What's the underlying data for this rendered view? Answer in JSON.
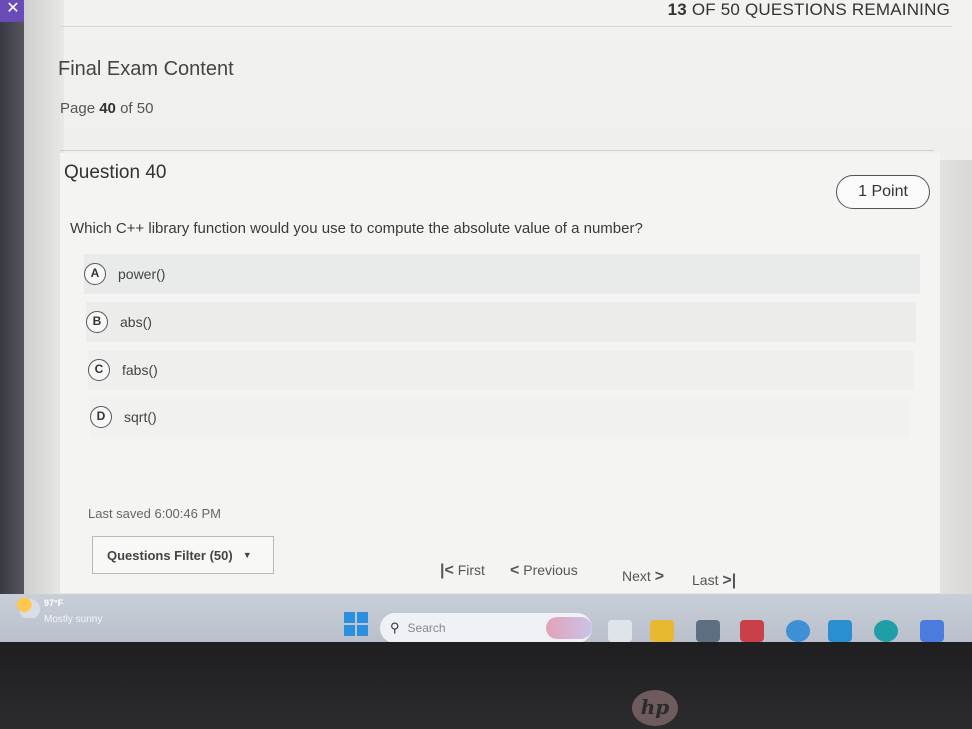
{
  "header": {
    "remaining_count": "13",
    "remaining_text": "OF 50 QUESTIONS REMAINING",
    "close_glyph": "✕"
  },
  "exam": {
    "title": "Final Exam Content",
    "page_label": "Page",
    "page_current": "40",
    "page_of": "of 50"
  },
  "question": {
    "title": "Question 40",
    "points": "1 Point",
    "text": "Which C++ library function would you use to compute the absolute value of a number?",
    "options": [
      {
        "letter": "A",
        "label": "power()"
      },
      {
        "letter": "B",
        "label": "abs()"
      },
      {
        "letter": "C",
        "label": "fabs()"
      },
      {
        "letter": "D",
        "label": "sqrt()"
      }
    ]
  },
  "footer": {
    "last_saved": "Last saved 6:00:46 PM",
    "filter_label": "Questions Filter (50)",
    "nav_first": "First",
    "nav_previous": "Previous",
    "nav_next": "Next",
    "nav_last": "Last"
  },
  "taskbar": {
    "weather_temp": "97°F",
    "weather_desc": "Mostly sunny",
    "search_placeholder": "Search"
  },
  "device": {
    "brand": "hp"
  },
  "icons": {
    "close": "close-icon",
    "caret": "chevron-down-icon",
    "first": "skip-first-icon",
    "previous": "chevron-left-icon",
    "next": "chevron-right-icon",
    "last": "skip-last-icon",
    "search": "search-icon",
    "windows": "windows-start-icon",
    "weather": "weather-icon"
  }
}
